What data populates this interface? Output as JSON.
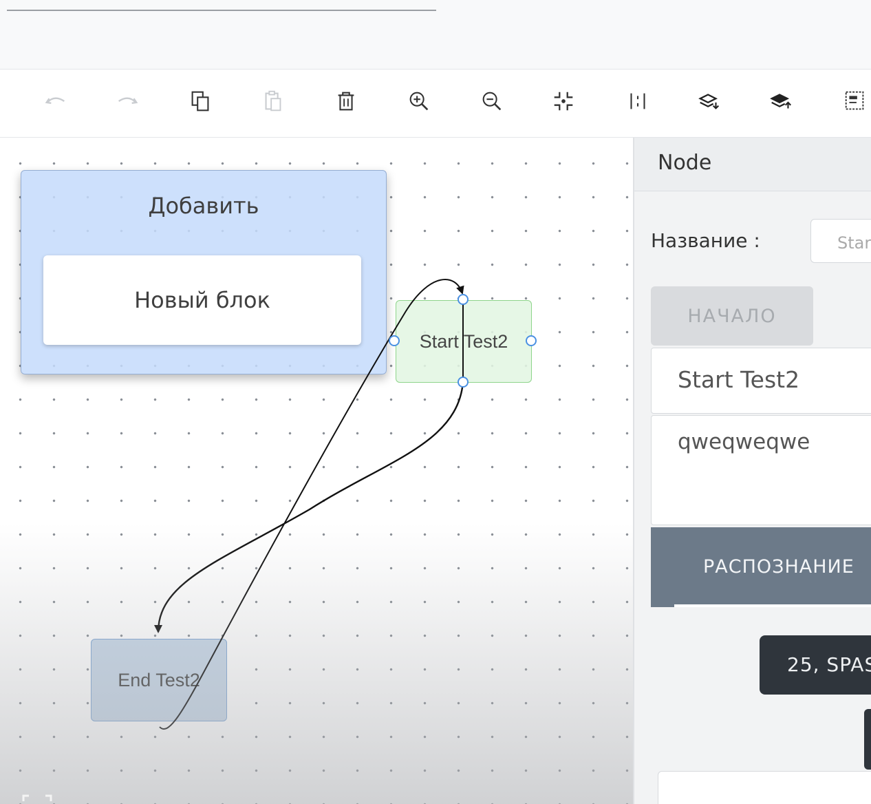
{
  "toolbar": {
    "undo": "undo-icon",
    "redo": "redo-icon",
    "copy": "copy-icon",
    "paste": "paste-icon",
    "delete": "trash-icon",
    "zoom_in": "zoom-in-icon",
    "zoom_out": "zoom-out-icon",
    "fit": "fit-to-screen-icon",
    "align": "align-icon",
    "send_back": "send-to-back-icon",
    "bring_front": "bring-to-front-icon",
    "group": "group-icon"
  },
  "palette": {
    "title": "Добавить",
    "block_label": "Новый блок"
  },
  "diagram": {
    "nodes": [
      {
        "id": "start",
        "label": "Start Test2"
      },
      {
        "id": "end",
        "label": "End Test2"
      }
    ]
  },
  "panel": {
    "title": "Node",
    "name_label": "Название :",
    "name_value": "Star",
    "start_button": "НАЧАЛО",
    "title_field": "Start Test2",
    "description_field": "qweqweqwe",
    "recognition_button": "РАСПОЗНАНИЕ",
    "dark_button": "25, SPAS"
  },
  "colors": {
    "accent_blue_panel": "#c4dbfb",
    "start_node_fill": "#e2f6e2",
    "start_node_border": "#8ed48a",
    "end_node_fill": "#c7d7e8",
    "recognition_button": "#6c7a89",
    "dark_button": "#2f353c",
    "handle": "#4a90e2"
  }
}
